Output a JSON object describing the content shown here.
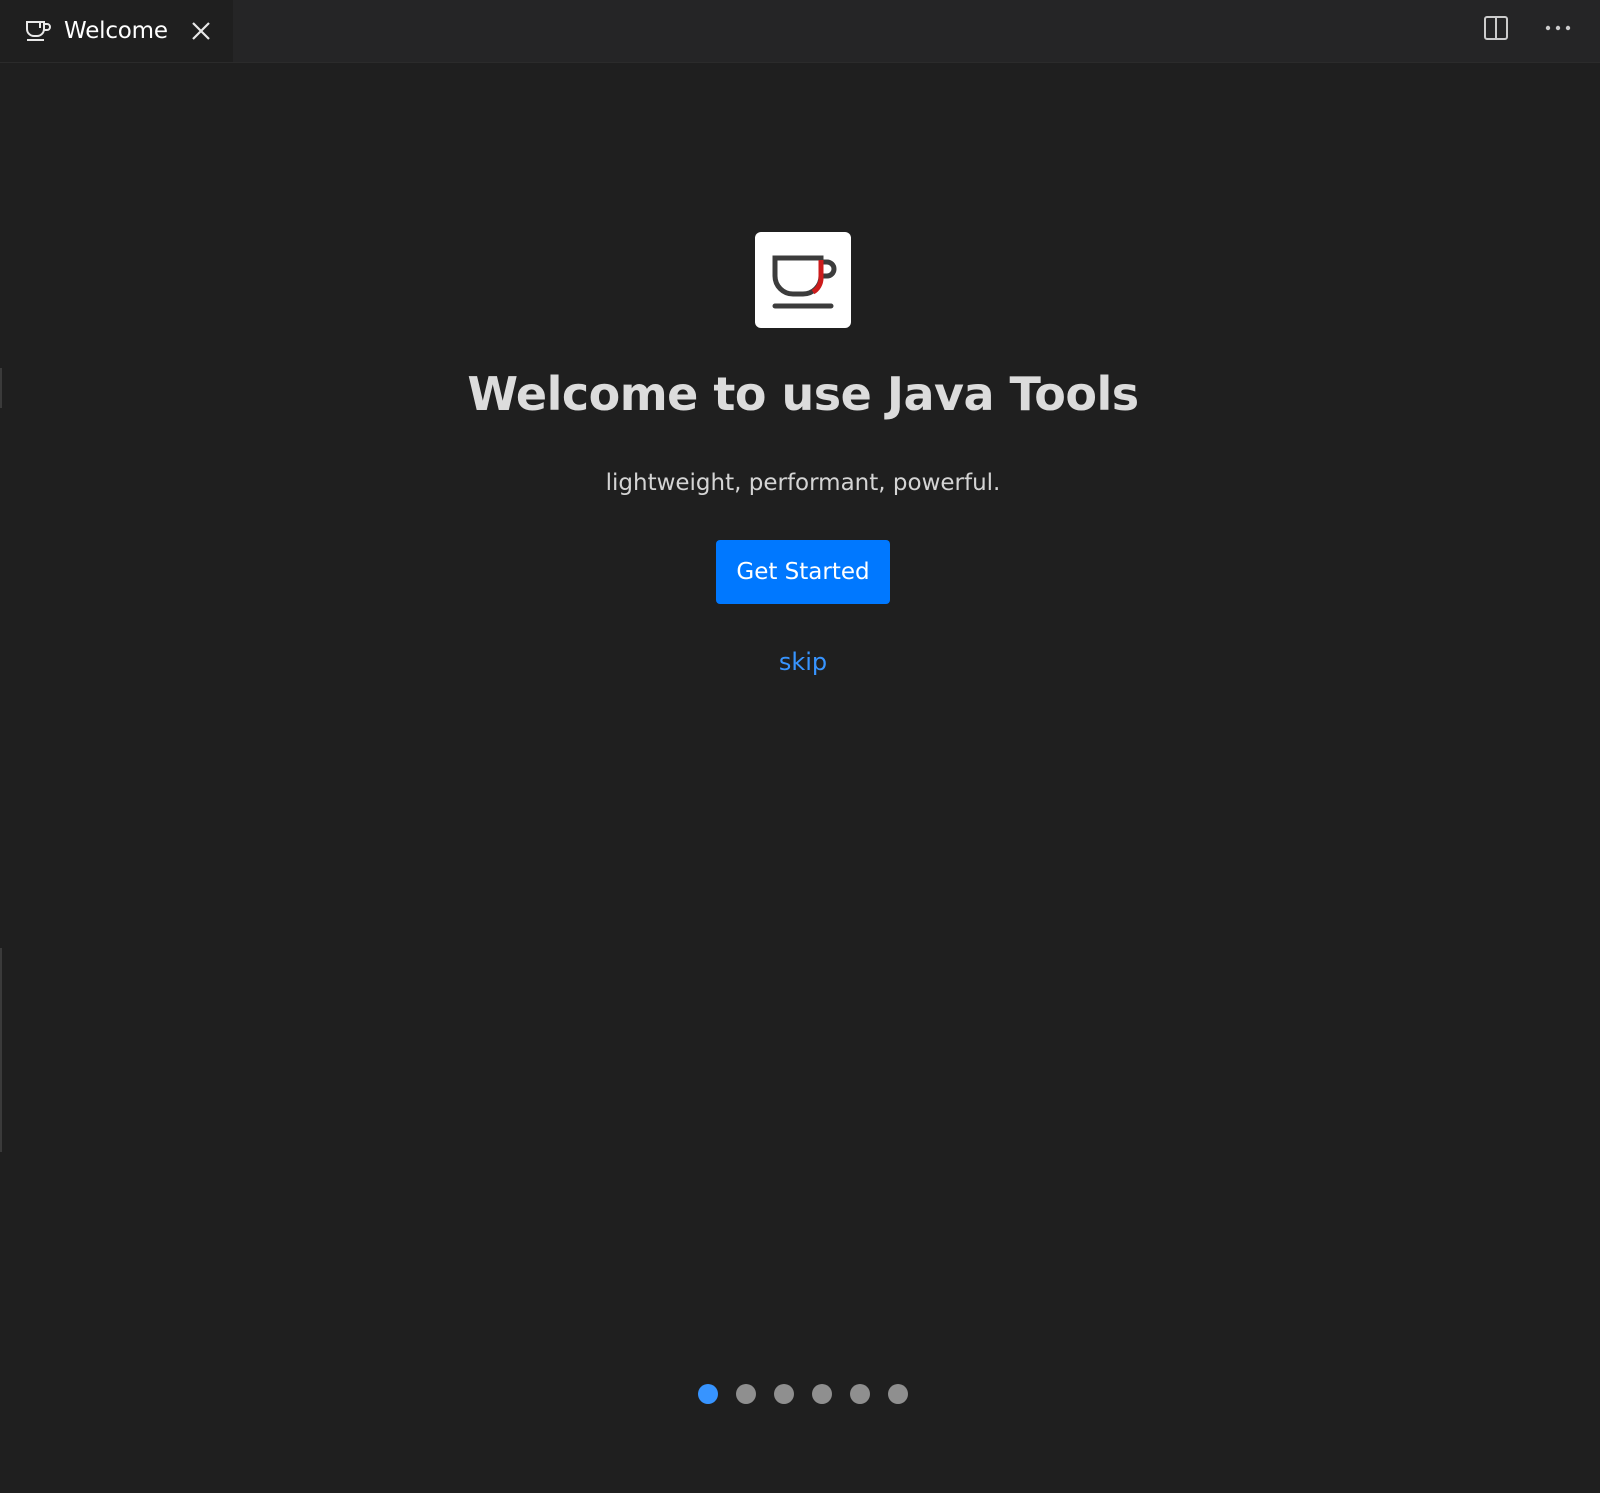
{
  "tabbar": {
    "tab": {
      "label": "Welcome",
      "icon": "coffee-cup-icon",
      "close_icon": "close-icon"
    },
    "actions": [
      {
        "name": "split-editor-icon"
      },
      {
        "name": "more-actions-icon"
      }
    ]
  },
  "welcome": {
    "logo_icon": "java-coffee-cup-logo",
    "title": "Welcome to use Java Tools",
    "subtitle": "lightweight, performant, powerful.",
    "primary_button": "Get Started",
    "skip_link": "skip"
  },
  "pagination": {
    "total": 6,
    "current": 1
  },
  "colors": {
    "background": "#1f1f1f",
    "accent": "#0078ff",
    "link": "#3794ff",
    "inactive_dot": "#8f8f8f"
  }
}
